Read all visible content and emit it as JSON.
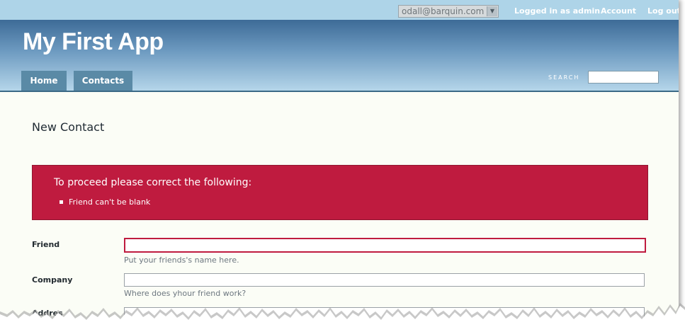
{
  "topbar": {
    "account_select_value": "odall@barquin.com",
    "logged_in_text": "Logged in as admin",
    "account_link": "Account",
    "logout_link": "Log out"
  },
  "header": {
    "app_title": "My First App",
    "nav_tabs": [
      {
        "label": "Home"
      },
      {
        "label": "Contacts"
      }
    ],
    "search_label": "SEARCH",
    "search_value": ""
  },
  "main": {
    "page_title": "New Contact",
    "error": {
      "heading": "To proceed please correct the following:",
      "items": [
        "Friend can't be blank"
      ]
    },
    "fields": [
      {
        "label": "Friend",
        "value": "",
        "hint": "Put your friends's name here."
      },
      {
        "label": "Company",
        "value": "",
        "hint": "Where does yhour friend work?"
      },
      {
        "label": "Addres"
      }
    ]
  },
  "colors": {
    "topbar_bg": "#aed4e8",
    "header_gradient_top": "#3d6b97",
    "header_gradient_bottom": "#b5d6ea",
    "nav_tab_bg": "#5a8aa6",
    "error_bg": "#bf1b3f",
    "page_bg": "#fbfdf6"
  },
  "icons": {
    "select_caret": "chevron-down-icon"
  }
}
